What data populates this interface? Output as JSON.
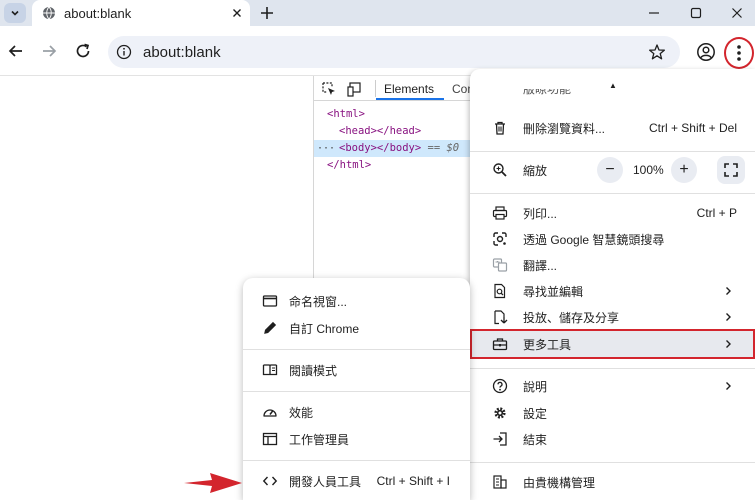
{
  "tab": {
    "title": "about:blank"
  },
  "omnibox": {
    "url": "about:blank"
  },
  "devtools": {
    "tabs": [
      "Elements",
      "Con"
    ],
    "dom": {
      "html_open": "<html>",
      "head": "<head></head>",
      "body": "<body></body>",
      "body_eq": "== $0",
      "html_close": "</html>",
      "dots": "···"
    }
  },
  "menu": {
    "top_caret": "▲",
    "partial_label": "版瞭功能",
    "items": [
      {
        "label": "刪除瀏覽資料...",
        "shortcut": "Ctrl + Shift + Del",
        "icon": "trash-icon"
      },
      {
        "label": "縮放",
        "icon": "zoom-icon"
      },
      {
        "label": "列印...",
        "shortcut": "Ctrl + P",
        "icon": "printer-icon"
      },
      {
        "label": "透過 Google 智慧鏡頭搜尋",
        "icon": "lens-icon"
      },
      {
        "label": "翻譯...",
        "icon": "translate-icon"
      },
      {
        "label": "尋找並編輯",
        "icon": "find-icon"
      },
      {
        "label": "投放、儲存及分享",
        "icon": "share-icon"
      },
      {
        "label": "更多工具",
        "icon": "toolbox-icon"
      },
      {
        "label": "說明",
        "icon": "help-icon"
      },
      {
        "label": "設定",
        "icon": "gear-icon"
      },
      {
        "label": "結束",
        "icon": "exit-icon"
      },
      {
        "label": "由貴機構管理",
        "icon": "building-icon"
      }
    ],
    "zoom": {
      "minus": "−",
      "value": "100%",
      "plus": "+"
    }
  },
  "submenu": {
    "items": [
      {
        "label": "命名視窗...",
        "icon": "window-icon"
      },
      {
        "label": "自訂 Chrome",
        "icon": "pencil-icon"
      },
      {
        "label": "閱讀模式",
        "icon": "book-icon"
      },
      {
        "label": "效能",
        "icon": "speedometer-icon"
      },
      {
        "label": "工作管理員",
        "icon": "task-manager-icon"
      },
      {
        "label": "開發人員工具",
        "shortcut": "Ctrl + Shift + I",
        "icon": "code-icon"
      }
    ]
  },
  "colors": {
    "highlight": "#d3252d",
    "tabstrip": "#dfe5ee",
    "omnibox": "#eef1f8"
  }
}
